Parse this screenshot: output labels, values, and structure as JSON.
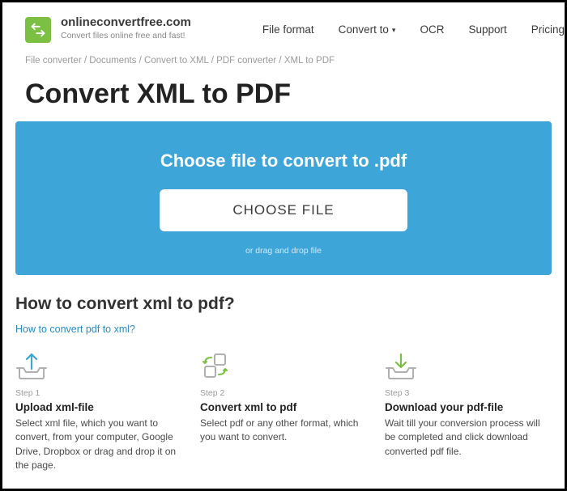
{
  "brand": {
    "name": "onlineconvertfree.com",
    "tagline": "Convert files online free and fast!"
  },
  "nav": {
    "file_format": "File format",
    "convert_to": "Convert to",
    "ocr": "OCR",
    "support": "Support",
    "pricing": "Pricing"
  },
  "crumbs": {
    "c0": "File converter",
    "c1": "Documents",
    "c2": "Convert to XML",
    "c3": "PDF converter",
    "c4": "XML to PDF",
    "sep": " / "
  },
  "title": "Convert XML to PDF",
  "dropzone": {
    "heading": "Choose file to convert to .pdf",
    "button": "CHOOSE FILE",
    "hint": "or drag and drop file"
  },
  "howto": {
    "title": "How to convert xml to pdf?",
    "reverse_link": "How to convert pdf to xml?"
  },
  "steps": [
    {
      "num": "Step 1",
      "title": "Upload xml-file",
      "desc": "Select xml file, which you want to convert, from your computer, Google Drive, Dropbox or drag and drop it on the page."
    },
    {
      "num": "Step 2",
      "title": "Convert xml to pdf",
      "desc": "Select pdf or any other format, which you want to convert."
    },
    {
      "num": "Step 3",
      "title": "Download your pdf-file",
      "desc": "Wait till your conversion process will be completed and click download converted pdf file."
    }
  ],
  "colors": {
    "accent_green": "#7bc043",
    "accent_blue": "#3ea5d9",
    "link": "#2a8cc7"
  }
}
